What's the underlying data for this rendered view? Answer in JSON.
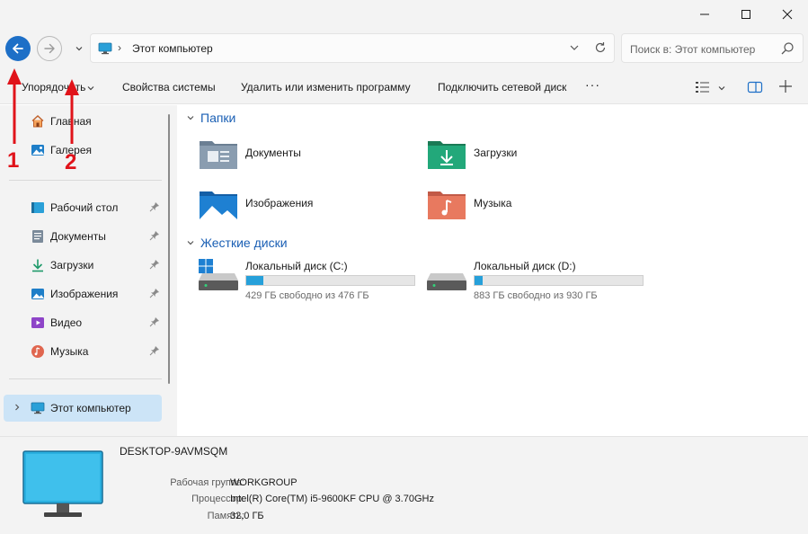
{
  "window": {
    "controls": [
      "minimize-icon",
      "maximize-icon",
      "close-icon"
    ]
  },
  "address": {
    "path": "Этот компьютер",
    "search_placeholder": "Поиск в: Этот компьютер"
  },
  "toolbar": {
    "sort_label": "Упорядочить",
    "system_props": "Свойства системы",
    "uninstall": "Удалить или изменить программу",
    "map_drive": "Подключить сетевой диск",
    "more": "···"
  },
  "sidebar": {
    "top": [
      {
        "label": "Главная",
        "icon": "home-icon"
      },
      {
        "label": "Галерея",
        "icon": "gallery-icon"
      }
    ],
    "pinned": [
      {
        "label": "Рабочий стол",
        "icon": "desktop-icon"
      },
      {
        "label": "Документы",
        "icon": "documents-icon"
      },
      {
        "label": "Загрузки",
        "icon": "downloads-icon"
      },
      {
        "label": "Изображения",
        "icon": "pictures-icon"
      },
      {
        "label": "Видео",
        "icon": "video-icon"
      },
      {
        "label": "Музыка",
        "icon": "music-icon"
      }
    ],
    "this_pc": "Этот компьютер"
  },
  "main": {
    "folders_header": "Папки",
    "folders": [
      {
        "label": "Документы",
        "icon": "documents-folder-icon"
      },
      {
        "label": "Загрузки",
        "icon": "downloads-folder-icon"
      },
      {
        "label": "Изображения",
        "icon": "pictures-folder-icon"
      },
      {
        "label": "Музыка",
        "icon": "music-folder-icon"
      }
    ],
    "drives_header": "Жесткие диски",
    "drives": [
      {
        "label": "Локальный диск (C:)",
        "free_text": "429 ГБ свободно из 476 ГБ",
        "used_fraction": 0.1
      },
      {
        "label": "Локальный диск (D:)",
        "free_text": "883 ГБ свободно из 930 ГБ",
        "used_fraction": 0.05
      }
    ]
  },
  "details": {
    "computer_name": "DESKTOP-9AVMSQM",
    "rows": [
      {
        "key": "Рабочая группа:",
        "value": "WORKGROUP"
      },
      {
        "key": "Процессор:",
        "value": "Intel(R) Core(TM) i5-9600KF CPU @ 3.70GHz"
      },
      {
        "key": "Память:",
        "value": "32,0 ГБ"
      }
    ]
  },
  "annotations": {
    "marker1": "1",
    "marker2": "2",
    "color": "#e0131a"
  },
  "colors": {
    "accent": "#1d6fc7",
    "selection": "#cce4f7",
    "drive_fill": "#26a0da"
  }
}
